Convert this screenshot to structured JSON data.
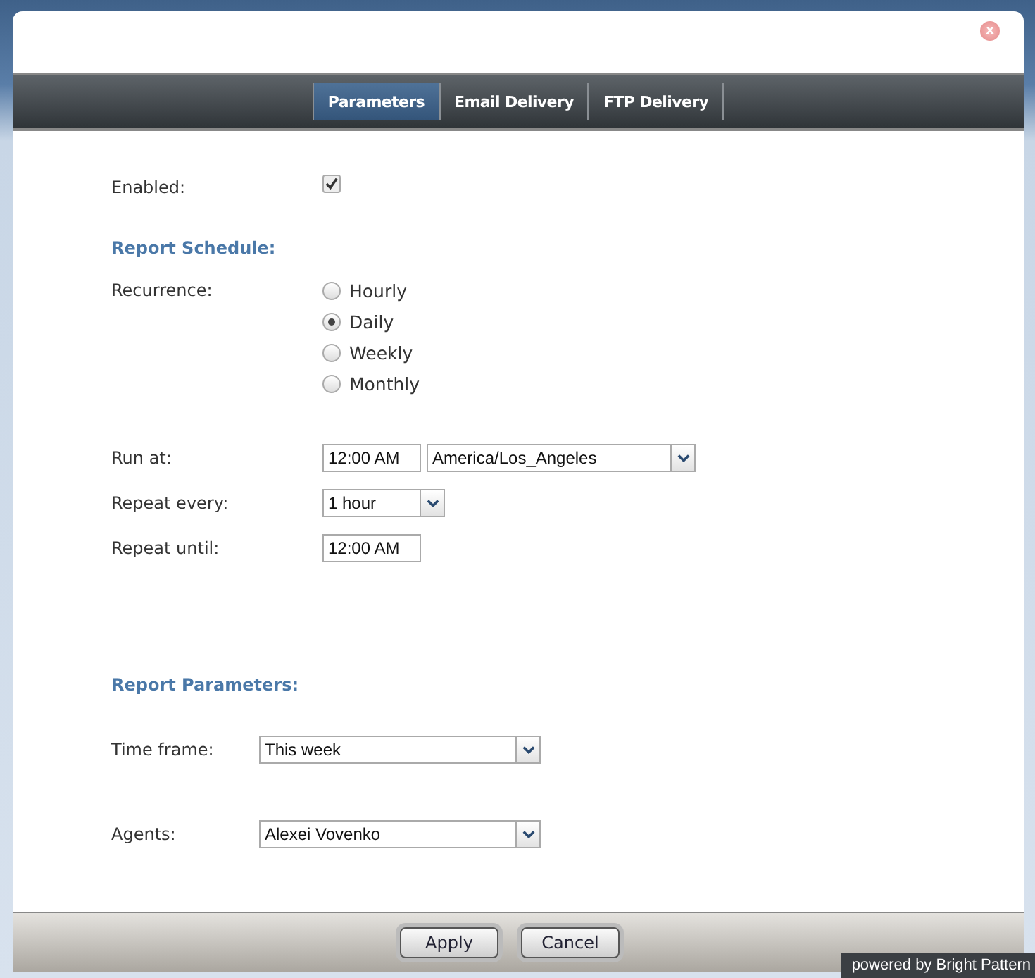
{
  "dialog": {
    "close": "x"
  },
  "tabs": [
    {
      "label": "Parameters",
      "selected": true
    },
    {
      "label": "Email Delivery",
      "selected": false
    },
    {
      "label": "FTP Delivery",
      "selected": false
    }
  ],
  "enabled": {
    "label": "Enabled:",
    "checked": true
  },
  "schedule": {
    "heading": "Report Schedule:",
    "recurrence_label": "Recurrence:",
    "recurrence": [
      {
        "label": "Hourly",
        "selected": false
      },
      {
        "label": "Daily",
        "selected": true
      },
      {
        "label": "Weekly",
        "selected": false
      },
      {
        "label": "Monthly",
        "selected": false
      }
    ],
    "run_at": {
      "label": "Run at:",
      "time": "12:00 AM",
      "timezone": "America/Los_Angeles"
    },
    "repeat_every": {
      "label": "Repeat every:",
      "value": "1 hour"
    },
    "repeat_until": {
      "label": "Repeat until:",
      "time": "12:00 AM"
    }
  },
  "parameters": {
    "heading": "Report Parameters:",
    "time_frame": {
      "label": "Time frame:",
      "value": "This week"
    },
    "agents": {
      "label": "Agents:",
      "value": "Alexei Vovenko"
    }
  },
  "buttons": [
    "Apply",
    "Cancel"
  ],
  "footer_badge": "powered by Bright Pattern"
}
